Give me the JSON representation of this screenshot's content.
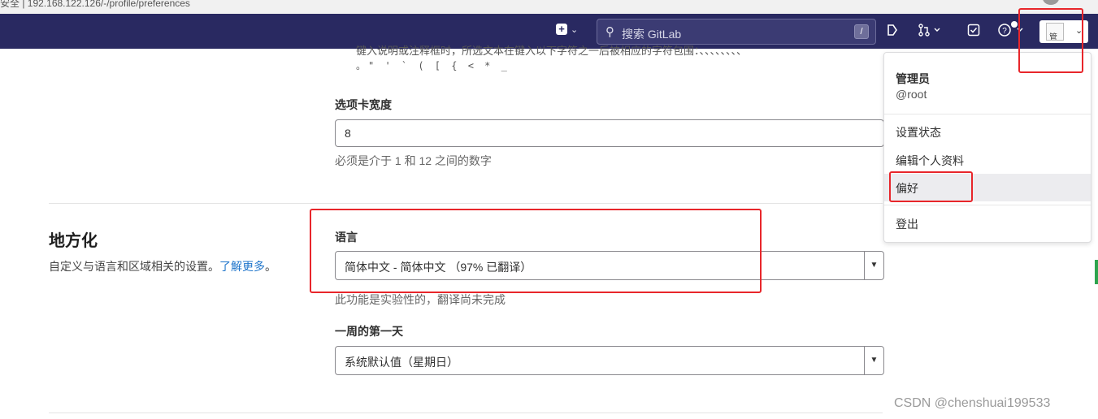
{
  "browser": {
    "url_fragment": "安全 | 192.168.122.126/-/profile/preferences"
  },
  "navbar": {
    "search_placeholder": "搜索 GitLab",
    "search_shortcut": "/",
    "avatar_alt": "管"
  },
  "main": {
    "truncated_help_line1": "键入说明或注释框时，所选文本在键入以下字符之一后被相应的字符包围：、、、、、、、、",
    "truncated_help_line2": "。\" ' ` ( [ { < * _",
    "tab_width_label": "选项卡宽度",
    "tab_width_value": "8",
    "tab_width_help": "必须是介于 1 和 12 之间的数字",
    "localization_title": "地方化",
    "localization_desc": "自定义与语言和区域相关的设置。",
    "learn_more": "了解更多",
    "learn_more_suffix": "。",
    "language_label": "语言",
    "language_value": "简体中文 - 简体中文 （97% 已翻译）",
    "language_help": "此功能是实验性的，翻译尚未完成",
    "first_day_label": "一周的第一天",
    "first_day_value": "系统默认值（星期日）"
  },
  "dropdown": {
    "name": "管理员",
    "handle": "@root",
    "items": [
      {
        "label": "设置状态"
      },
      {
        "label": "编辑个人资料"
      },
      {
        "label": "偏好"
      },
      {
        "label": "登出"
      }
    ]
  },
  "watermark": "CSDN @chenshuai199533",
  "icons": {
    "new": "plus-square-icon",
    "search": "search-icon",
    "issues": "issues-icon",
    "merge_requests": "merge-request-icon",
    "todos": "todo-icon",
    "help": "help-icon",
    "chevron": "chevron-down-icon"
  },
  "colors": {
    "navbar": "#292961",
    "link": "#1f75cb",
    "annotation": "#e8262b"
  }
}
